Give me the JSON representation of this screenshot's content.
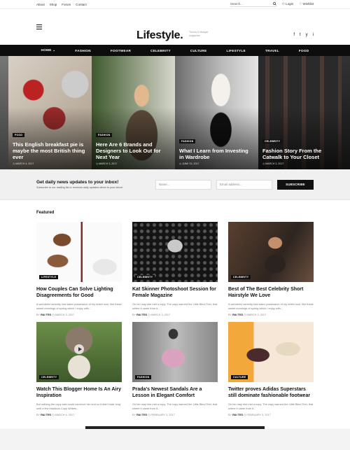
{
  "topbar": {
    "links": [
      "About",
      "Shop",
      "Forum",
      "Contact"
    ],
    "search_placeholder": "Search...",
    "login": "Login",
    "wishlist": "Wishlist"
  },
  "header": {
    "logo": "Lifestyle.",
    "tagline": "Trends & lifestyle magazine",
    "social": [
      "f",
      "t",
      "y",
      "i"
    ]
  },
  "nav": {
    "items": [
      "HOME",
      "FASHION",
      "FOOTWEAR",
      "CELEBRITY",
      "CULTURE",
      "LIFESTYLE",
      "TRAVEL",
      "FOOD"
    ]
  },
  "hero": [
    {
      "tag": "FOOD",
      "title": "This English breakfast pie is maybe the most British thing ever",
      "date": "MARCH 4, 2017"
    },
    {
      "tag": "FASHION",
      "title": "Here Are 6 Brands and Designers to Look Out for Next Year",
      "date": "MARCH 3, 2017"
    },
    {
      "tag": "FASHION",
      "title": "What I Learn from Investing in Wardrobe",
      "date": "JUNE 15, 2017"
    },
    {
      "tag": "CELEBRITY",
      "title": "Fashion Story From the Catwalk to Your Closet",
      "date": "MARCH 3, 2017"
    }
  ],
  "newsletter": {
    "heading": "Get daily news updates to your inbox!",
    "sub": "Subscribe to our mailing list to receives daily updates direct to your inbox!",
    "name_placeholder": "Name...",
    "email_placeholder": "Email address...",
    "button": "SUBSCRIBE"
  },
  "featured": {
    "heading": "Featured",
    "cards": [
      {
        "tag": "LIFESTYLE",
        "title": "How Couples Can Solve Lighting Disagreements for Good",
        "excerpt": "A wonderful serenity has taken possession of my entire soul, like these sweet mornings of spring which I enjoy with...",
        "by": "BY",
        "author": "RAI TES",
        "date": "MARCH 3, 2017"
      },
      {
        "tag": "CELEBRITY",
        "title": "Kat Skinner Photoshoot Session for Female Magazine",
        "excerpt": "On her way she met a copy. The copy warned the Little Blind Text, that where it came from it...",
        "by": "BY",
        "author": "RAI TES",
        "date": "MARCH 3, 2017"
      },
      {
        "tag": "CELEBRITY",
        "title": "Best of The Best Celebrity Short Hairstyle We Love",
        "excerpt": "A wonderful serenity has taken possession of my entire soul, like these sweet mornings of spring which I enjoy with...",
        "by": "BY",
        "author": "RAI TES",
        "date": "MARCH 3, 2017"
      },
      {
        "tag": "CELEBRITY",
        "title": "Watch This Blogger Home Is An Airy Inspiration",
        "excerpt": "But nothing the copy said could convince her and so it didn't take long until a few insidious Copy Writers...",
        "by": "BY",
        "author": "RAI TES",
        "date": "MARCH 6, 2017"
      },
      {
        "tag": "FASHION",
        "title": "Prada's Newest Sandals Are a Lesson in Elegant Comfort",
        "excerpt": "On her way she met a copy. The copy warned the Little Blind Text, that where it came from it...",
        "by": "BY",
        "author": "RAI TES",
        "date": "FEBRUARY 3, 2017"
      },
      {
        "tag": "CULTURE",
        "title": "Twitter proves Adidas Superstars still dominate fashionable footwear",
        "excerpt": "On her way she met a copy. The copy warned the Little Blind Text, that where it came from it...",
        "by": "BY",
        "author": "RAI TES",
        "date": "FEBRUARY 3, 2017"
      }
    ]
  }
}
